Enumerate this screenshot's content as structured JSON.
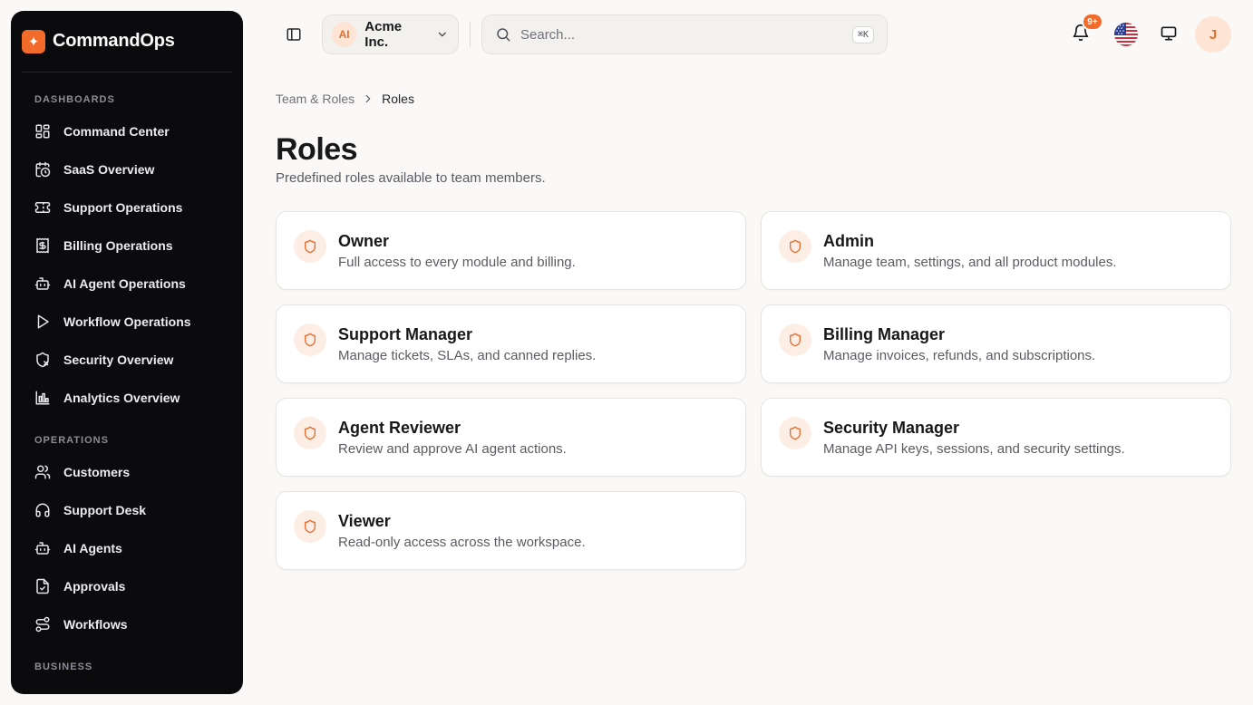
{
  "brand": {
    "name": "CommandOps"
  },
  "sidebar": {
    "sections": [
      {
        "title": "DASHBOARDS",
        "items": [
          {
            "label": "Command Center",
            "icon": "dashboard-icon"
          },
          {
            "label": "SaaS Overview",
            "icon": "calendar-clock-icon"
          },
          {
            "label": "Support Operations",
            "icon": "ticket-icon"
          },
          {
            "label": "Billing Operations",
            "icon": "receipt-icon"
          },
          {
            "label": "AI Agent Operations",
            "icon": "bot-icon"
          },
          {
            "label": "Workflow Operations",
            "icon": "play-icon"
          },
          {
            "label": "Security Overview",
            "icon": "shield-x-icon"
          },
          {
            "label": "Analytics Overview",
            "icon": "bar-chart-icon"
          }
        ]
      },
      {
        "title": "OPERATIONS",
        "items": [
          {
            "label": "Customers",
            "icon": "users-icon"
          },
          {
            "label": "Support Desk",
            "icon": "headset-icon"
          },
          {
            "label": "AI Agents",
            "icon": "bot-icon"
          },
          {
            "label": "Approvals",
            "icon": "clipboard-check-icon"
          },
          {
            "label": "Workflows",
            "icon": "workflow-icon"
          }
        ]
      },
      {
        "title": "BUSINESS",
        "items": []
      }
    ]
  },
  "topbar": {
    "org": {
      "initials": "AI",
      "name": "Acme Inc."
    },
    "search": {
      "placeholder": "Search...",
      "shortcut": "⌘K"
    },
    "notifications": {
      "badge": "9+"
    },
    "user": {
      "initial": "J"
    }
  },
  "breadcrumb": {
    "parent": "Team & Roles",
    "current": "Roles"
  },
  "page": {
    "title": "Roles",
    "subtitle": "Predefined roles available to team members."
  },
  "roles": [
    {
      "name": "Owner",
      "description": "Full access to every module and billing."
    },
    {
      "name": "Admin",
      "description": "Manage team, settings, and all product modules."
    },
    {
      "name": "Support Manager",
      "description": "Manage tickets, SLAs, and canned replies."
    },
    {
      "name": "Billing Manager",
      "description": "Manage invoices, refunds, and subscriptions."
    },
    {
      "name": "Agent Reviewer",
      "description": "Review and approve AI agent actions."
    },
    {
      "name": "Security Manager",
      "description": "Manage API keys, sessions, and security settings."
    },
    {
      "name": "Viewer",
      "description": "Read-only access across the workspace."
    }
  ],
  "colors": {
    "accent": "#f26b2a",
    "sidebar_bg": "#0b0b0e",
    "page_bg": "#faf9f7"
  }
}
